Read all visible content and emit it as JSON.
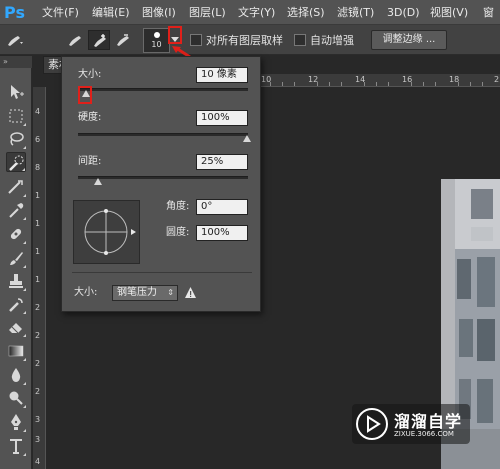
{
  "app": {
    "logo": "Ps"
  },
  "menu": {
    "items": [
      "文件(F)",
      "编辑(E)",
      "图像(I)",
      "图层(L)",
      "文字(Y)",
      "选择(S)",
      "滤镜(T)",
      "3D(D)",
      "视图(V)",
      "窗"
    ]
  },
  "options": {
    "brush_size": "10",
    "sample_all_layers": "对所有图层取样",
    "auto_enhance": "自动增强",
    "refine_edge": "调整边缘 ..."
  },
  "document": {
    "tab_label": "素材",
    "ruler_top": [
      "10",
      "12",
      "14",
      "16",
      "18",
      "2"
    ],
    "ruler_left": [
      "4",
      "6",
      "8",
      "1",
      "1",
      "1",
      "1",
      "2",
      "2",
      "2",
      "2",
      "3",
      "3",
      "4"
    ]
  },
  "brush_panel": {
    "size_label": "大小:",
    "size_value": "10 像素",
    "hardness_label": "硬度:",
    "hardness_value": "100%",
    "spacing_label": "间距:",
    "spacing_value": "25%",
    "angle_label": "角度:",
    "angle_value": "0°",
    "roundness_label": "圆度:",
    "roundness_value": "100%",
    "control_label": "大小:",
    "control_value": "钢笔压力",
    "sliders": {
      "size_percent": 0.05,
      "hardness_percent": 1.0,
      "spacing_percent": 0.12
    }
  },
  "watermark": {
    "title": "溜溜自学",
    "url": "ZIXUE.3066.COM"
  },
  "tool_names": [
    "move-tool",
    "marquee-tool",
    "lasso-tool",
    "quick-selection-tool",
    "crop-tool",
    "eyedropper-tool",
    "healing-brush-tool",
    "brush-tool",
    "clone-stamp-tool",
    "history-brush-tool",
    "eraser-tool",
    "gradient-tool",
    "blur-tool",
    "dodge-tool",
    "pen-tool",
    "type-tool"
  ],
  "highlight_color": "#e0201a"
}
